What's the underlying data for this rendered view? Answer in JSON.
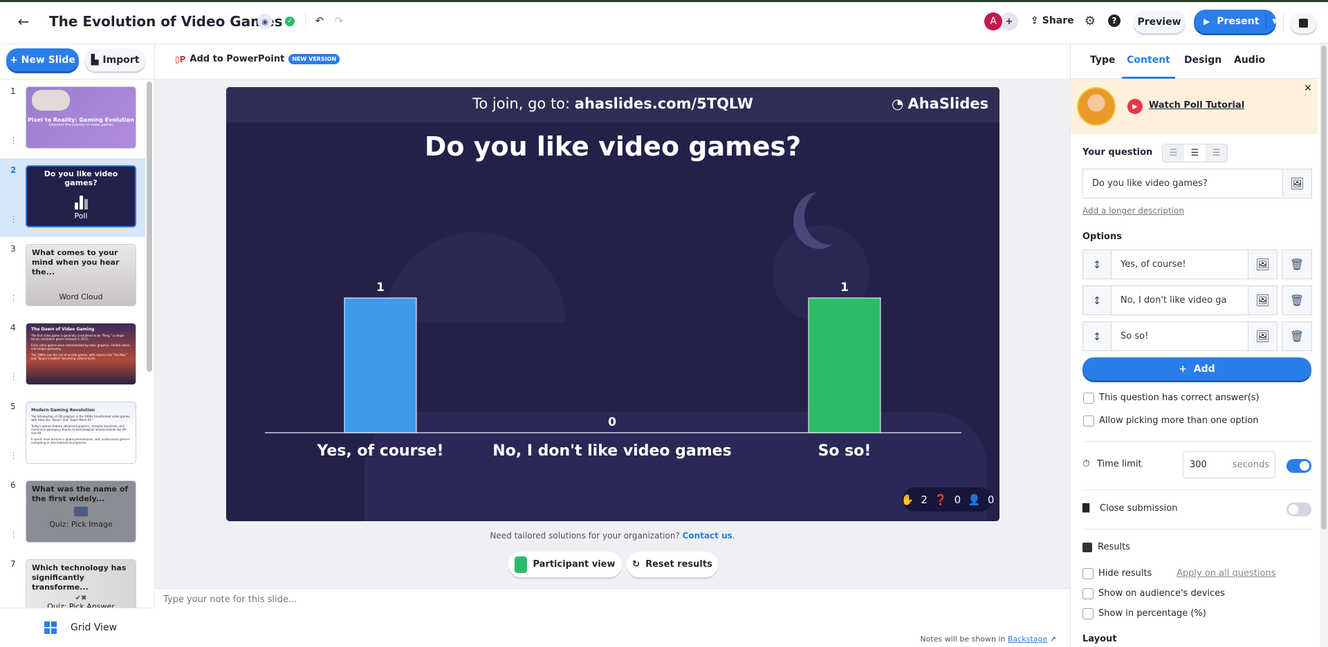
{
  "header": {
    "title": "The Evolution of Video Games",
    "avatar_initial": "A",
    "add_collab": "+",
    "share": "Share",
    "preview": "Preview",
    "present": "Present"
  },
  "sidebar": {
    "new_slide": "+ New Slide",
    "import": "Import",
    "grid_view": "Grid View",
    "slides": [
      {
        "num": "1",
        "title": "Pixel to Reality: Gaming Evolution",
        "subtitle": "Discover the journey of video games"
      },
      {
        "num": "2",
        "title": "Do you like video games?",
        "type": "Poll"
      },
      {
        "num": "3",
        "title": "What comes to your mind when you hear the...",
        "type": "Word Cloud"
      },
      {
        "num": "4",
        "title": "The Dawn of Video Gaming",
        "bullets": [
          "The first video game is generally considered to be \"Pong,\" a simple tennis simulation game released in 1972.",
          "Early video games were characterized by basic graphics, limited colors, and simple gameplay.",
          "The 1980s saw the rise of arcade games, with classics like \"Pac-Man\" and \"Space Invaders\" becoming cultural icons."
        ]
      },
      {
        "num": "5",
        "title": "Modern Gaming Revolution",
        "bullets": [
          "The introduction of 3D graphics in the 1990s transformed video games, with titles like \"Doom\" and \"Super Mario 64.\"",
          "Today's games feature advanced graphics, complex storylines, and immersive gameplay, thanks to technological advancements like VR and AR.",
          "E-sports have become a global phenomenon, with professional gamers competing in international tournaments."
        ]
      },
      {
        "num": "6",
        "title": "What was the name of the first widely...",
        "type": "Quiz: Pick Image"
      },
      {
        "num": "7",
        "title": "Which technology has significantly transforme...",
        "type": "Quiz: Pick Answer"
      }
    ]
  },
  "toolbar": {
    "add_to_ppt": "Add to PowerPoint",
    "badge": "NEW VERSION"
  },
  "slide": {
    "join_prefix": "To join, go to: ",
    "join_url": "ahaslides.com/5TQLW",
    "logo": "AhaSlides",
    "question": "Do you like video games?",
    "stats": {
      "reactions": "2",
      "questions": "0",
      "participants": "0"
    }
  },
  "chart_data": {
    "type": "bar",
    "categories": [
      "Yes, of course!",
      "No, I don't like video games",
      "So so!"
    ],
    "values": [
      1,
      0,
      1
    ],
    "colors": [
      "#3d9be9",
      "#3d9be9",
      "#2dbb6a"
    ]
  },
  "below": {
    "tailored": "Need tailored solutions for your organization? ",
    "contact": "Contact us",
    "participant_view": "Participant view",
    "reset_results": "Reset results"
  },
  "notes": {
    "placeholder": "Type your note for this slide...",
    "footer": "Notes will be shown in ",
    "backstage": "Backstage"
  },
  "panel": {
    "tabs": [
      "Type",
      "Content",
      "Design",
      "Audio"
    ],
    "active_tab": "Content",
    "tutorial": "Watch Poll Tutorial",
    "your_question": "Your question",
    "question_value": "Do you like video games?",
    "longer_desc": "Add a longer description",
    "options_label": "Options",
    "options": [
      "Yes, of course!",
      "No, I don't like video ga",
      "So so!"
    ],
    "add": "+  Add",
    "correct_answer": "This question has correct answer(s)",
    "multi": "Allow picking more than one option",
    "time_limit": "Time limit",
    "time_value": "300",
    "seconds": "seconds",
    "time_limit_on": true,
    "close_submission": "Close submission",
    "close_submission_on": false,
    "results": "Results",
    "hide_results": "Hide results",
    "apply_all": "Apply on all questions",
    "show_devices": "Show on audience's devices",
    "show_percent": "Show in percentage (%)",
    "layout": "Layout"
  },
  "colors": {
    "accent": "#2b7de9",
    "green": "#2dbb6a",
    "slide_bg": "#23204a"
  }
}
